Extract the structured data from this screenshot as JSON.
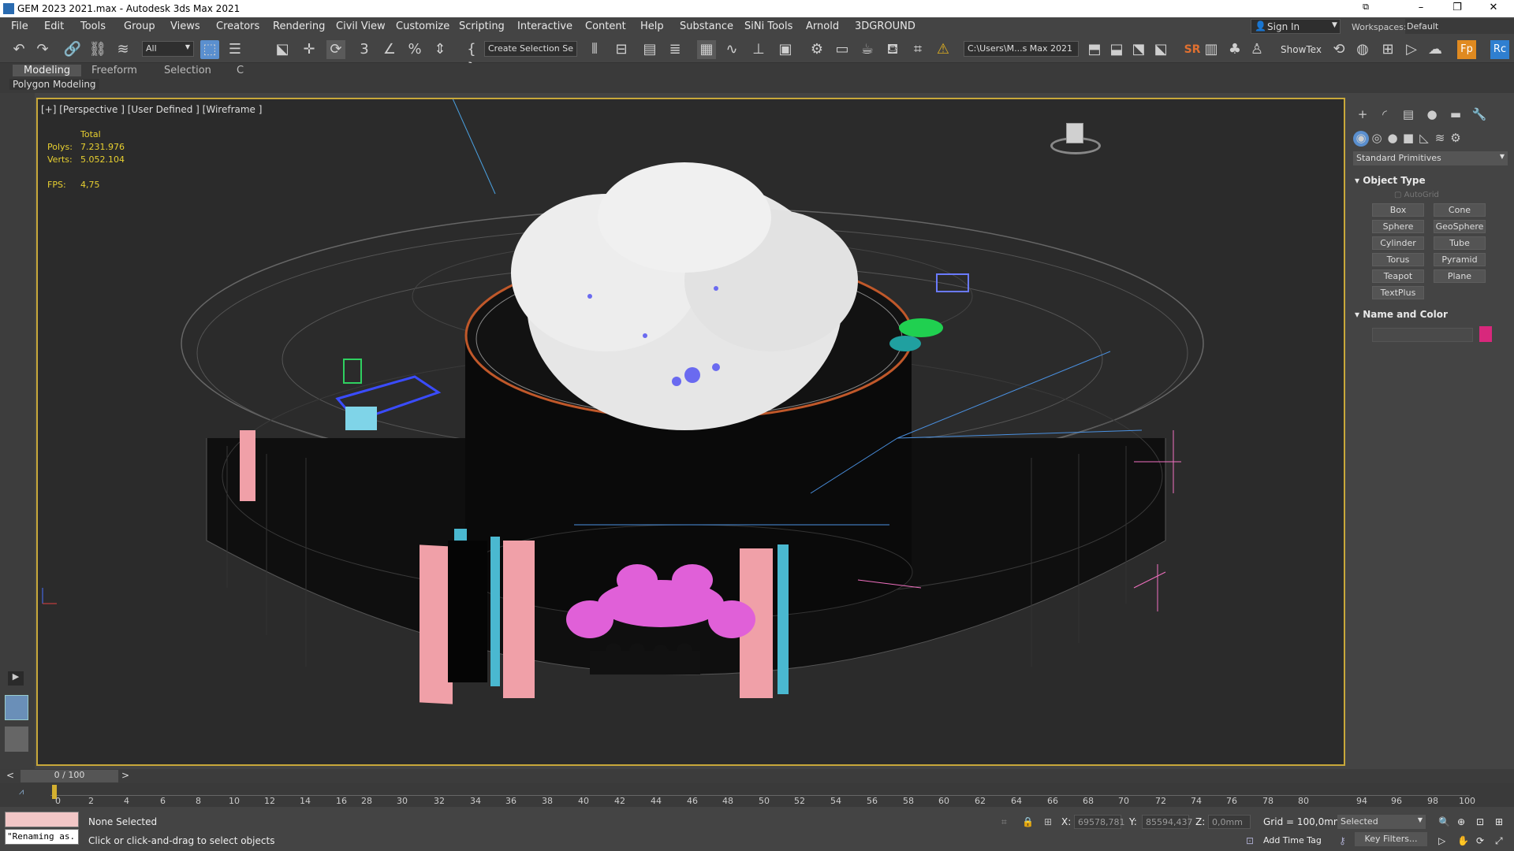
{
  "title": "GEM 2023 2021.max - Autodesk 3ds Max 2021",
  "menu": [
    "File",
    "Edit",
    "Tools",
    "Group",
    "Views",
    "Creators",
    "Rendering",
    "Civil View",
    "Customize",
    "Scripting",
    "Interactive",
    "Content",
    "Help",
    "Substance",
    "SiNi Tools",
    "Arnold",
    "3DGROUND"
  ],
  "signin": "Sign In",
  "workspaces_label": "Workspaces:",
  "workspace_value": "Default",
  "toolbar": {
    "filter": "All",
    "selection_set": "Create Selection Se",
    "path": "C:\\Users\\M...s Max 2021",
    "showtex": "ShowTex",
    "sr": "SR"
  },
  "ribbon": {
    "tabs": [
      "Modeling",
      "Freeform",
      "Selection",
      "C"
    ],
    "subtab": "Polygon Modeling"
  },
  "viewport": {
    "label": "[+] [Perspective ] [User Defined ] [Wireframe ]",
    "total_label": "Total",
    "polys_label": "Polys:",
    "polys": "7.231.976",
    "verts_label": "Verts:",
    "verts": "5.052.104",
    "fps_label": "FPS:",
    "fps": "4,75"
  },
  "panel": {
    "category": "Standard Primitives",
    "object_type": "Object Type",
    "autogrid": "AutoGrid",
    "buttons": [
      "Box",
      "Cone",
      "Sphere",
      "GeoSphere",
      "Cylinder",
      "Tube",
      "Torus",
      "Pyramid",
      "Teapot",
      "Plane",
      "TextPlus"
    ],
    "name_color": "Name and Color",
    "swatch_color": "#d8287c"
  },
  "time": {
    "slider": "0 / 100",
    "ticks": [
      "0",
      "2",
      "4",
      "6",
      "8",
      "10",
      "12",
      "14",
      "16",
      "28",
      "30",
      "32",
      "34",
      "36",
      "38",
      "40",
      "42",
      "44",
      "46",
      "48",
      "50",
      "52",
      "54",
      "56",
      "58",
      "60",
      "62",
      "64",
      "66",
      "68",
      "70",
      "72",
      "74",
      "76",
      "78",
      "80",
      "94",
      "96",
      "98",
      "100"
    ]
  },
  "status": {
    "script": "\"Renaming as.",
    "selection": "None Selected",
    "prompt": "Click or click-and-drag to select objects",
    "x_label": "X:",
    "x": "69578,781",
    "y_label": "Y:",
    "y": "85594,437",
    "z_label": "Z:",
    "z": "0,0mm",
    "grid": "Grid = 100,0mm",
    "key_mode": "Selected",
    "add_time_tag": "Add Time Tag",
    "key_filters": "Key Filters..."
  }
}
